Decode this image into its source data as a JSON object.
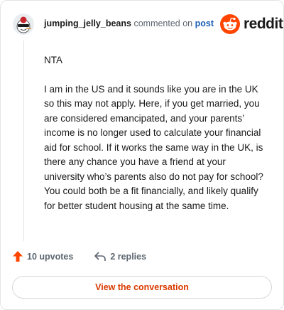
{
  "header": {
    "username": "jumping_jelly_beans",
    "action_text": "commented on",
    "post_link": "post"
  },
  "logo": {
    "text": "reddit",
    "icon": "reddit-snoo-icon",
    "brand_color": "#ff4500"
  },
  "comment": {
    "paragraphs": [
      "NTA",
      "I am in the US and it sounds like you are in the UK so this may not apply. Here, if you get married, you are considered emancipated, and your parents’ income is no longer used to calculate your financial aid for school. If it works the same way in the UK, is there any chance you have a friend at your university who’s parents also do not pay for school? You could both be a fit financially, and likely qualify for better student housing at the same time."
    ]
  },
  "actions": {
    "upvotes": "10 upvotes",
    "upvote_icon": "upvote-arrow-icon",
    "upvote_color": "#ff4500",
    "replies": "2 replies",
    "reply_icon": "reply-arrow-icon"
  },
  "cta": {
    "label": "View the conversation",
    "color": "#d93a00"
  }
}
